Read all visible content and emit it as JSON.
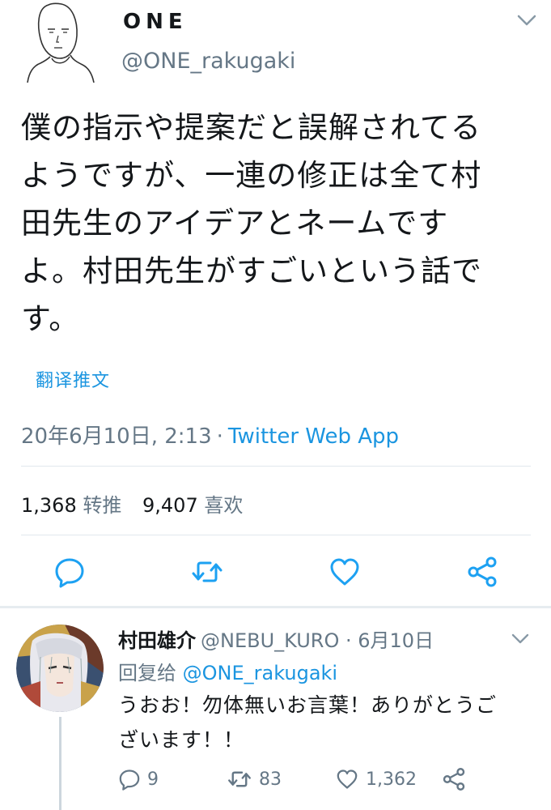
{
  "tweet": {
    "display_name": "ONE",
    "handle": "@ONE_rakugaki",
    "text": "僕の指示や提案だと誤解されてる\nようですが、一連の修正は全て村\n田先生のアイデアとネームです\nよ。村田先生がすごいという話で\nす。",
    "translate_label": "翻译推文",
    "time": "20年6月10日, 2:13",
    "separator": "·",
    "app": "Twitter Web App",
    "retweet_count": "1,368",
    "retweet_label": "转推",
    "like_count": "9,407",
    "like_label": "喜欢"
  },
  "reply": {
    "display_name": "村田雄介",
    "handle_date": "@NEBU_KURO · 6月10日",
    "replying_label": "回复给",
    "replying_to": "@ONE_rakugaki",
    "text": "うおお！勿体無いお言葉！ありがとうご\nざいます！！",
    "reply_count": "9",
    "retweet_count": "83",
    "like_count": "1,362"
  },
  "colors": {
    "accent": "#1b95e0",
    "muted": "#657786",
    "text": "#14171a",
    "icon": "#1da1f2",
    "divider": "#e1e8ed"
  },
  "icons": [
    "reply-icon",
    "retweet-icon",
    "like-icon",
    "share-icon",
    "chevron-down-icon"
  ]
}
